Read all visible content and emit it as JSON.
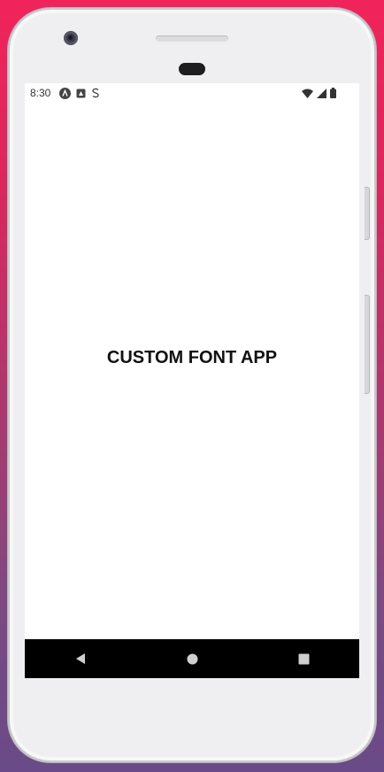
{
  "status_bar": {
    "time": "8:30",
    "left_icons": [
      "app-a-icon",
      "notification-icon",
      "sync-icon"
    ],
    "right_icons": [
      "wifi-icon",
      "cell-signal-icon",
      "battery-icon"
    ]
  },
  "app": {
    "title": "CUSTOM FONT APP"
  },
  "nav_bar": {
    "buttons": [
      "back-icon",
      "home-icon",
      "recents-icon"
    ]
  },
  "colors": {
    "background_top": "#f0245a",
    "background_bottom": "#6a4a88",
    "screen": "#ffffff",
    "nav_bar": "#000000",
    "text": "#111111"
  }
}
